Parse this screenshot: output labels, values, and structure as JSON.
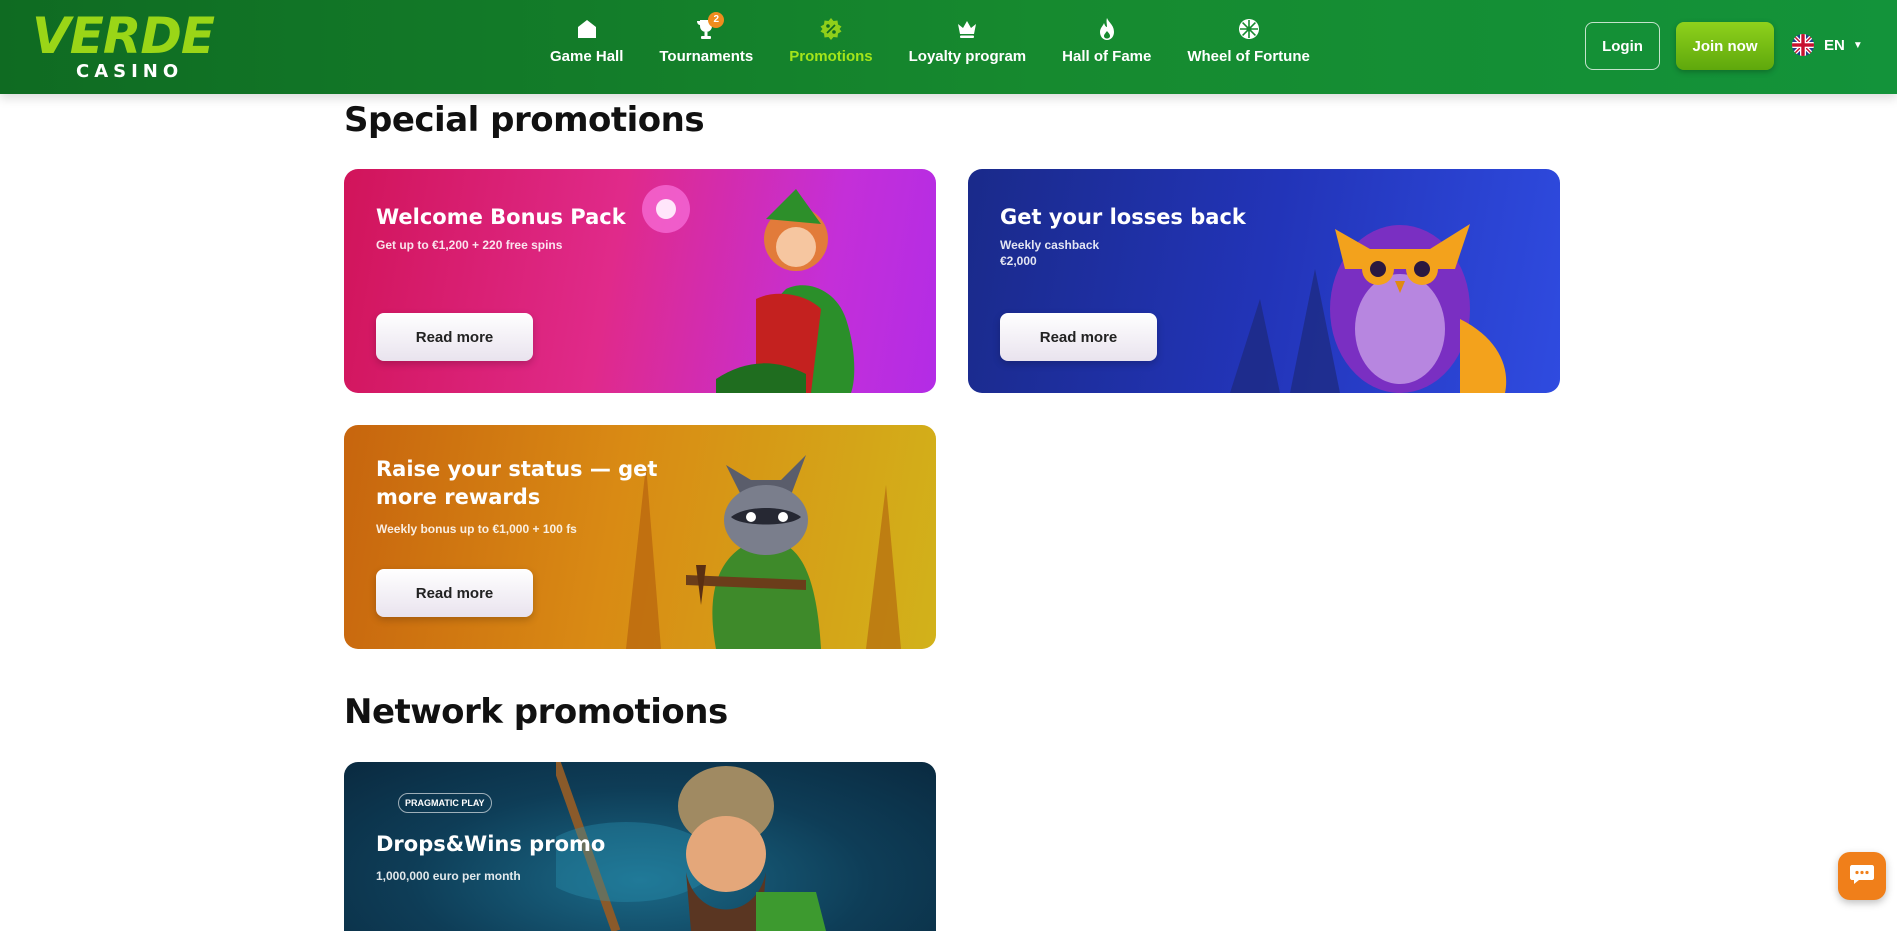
{
  "brand": {
    "name_top": "VERDE",
    "name_bottom": "CASINO"
  },
  "nav": {
    "items": [
      {
        "label": "Game Hall",
        "icon": "home-icon"
      },
      {
        "label": "Tournaments",
        "icon": "trophy-icon",
        "badge": "2"
      },
      {
        "label": "Promotions",
        "icon": "percent-badge-icon",
        "active": true
      },
      {
        "label": "Loyalty program",
        "icon": "crown-icon"
      },
      {
        "label": "Hall of Fame",
        "icon": "flame-icon"
      },
      {
        "label": "Wheel of Fortune",
        "icon": "wheel-icon"
      }
    ]
  },
  "auth": {
    "login_label": "Login",
    "join_label": "Join now"
  },
  "language": {
    "code": "EN",
    "icon": "uk-flag-icon"
  },
  "sections": {
    "special": {
      "title": "Special promotions",
      "cards": [
        {
          "title": "Welcome Bonus Pack",
          "subtitle": "Get up to €1,200 + 220 free spins",
          "button": "Read more"
        },
        {
          "title": "Get your losses back",
          "subtitle_line1": "Weekly cashback",
          "subtitle_line2": "€2,000",
          "button": "Read more"
        },
        {
          "title": "Raise your status — get more rewards",
          "subtitle": "Weekly bonus up to €1,000 + 100 fs",
          "button": "Read more"
        }
      ]
    },
    "network": {
      "title": "Network promotions",
      "cards": [
        {
          "provider_logo": "PRAGMATIC PLAY",
          "title": "Drops&Wins promo",
          "subtitle": "1,000,000 euro per month"
        }
      ]
    }
  },
  "chat": {
    "icon": "chat-bubble-icon"
  },
  "colors": {
    "header": "#168a2f",
    "accent": "#a3e51a",
    "join": "#7cc216",
    "chat": "#f07f1a"
  }
}
